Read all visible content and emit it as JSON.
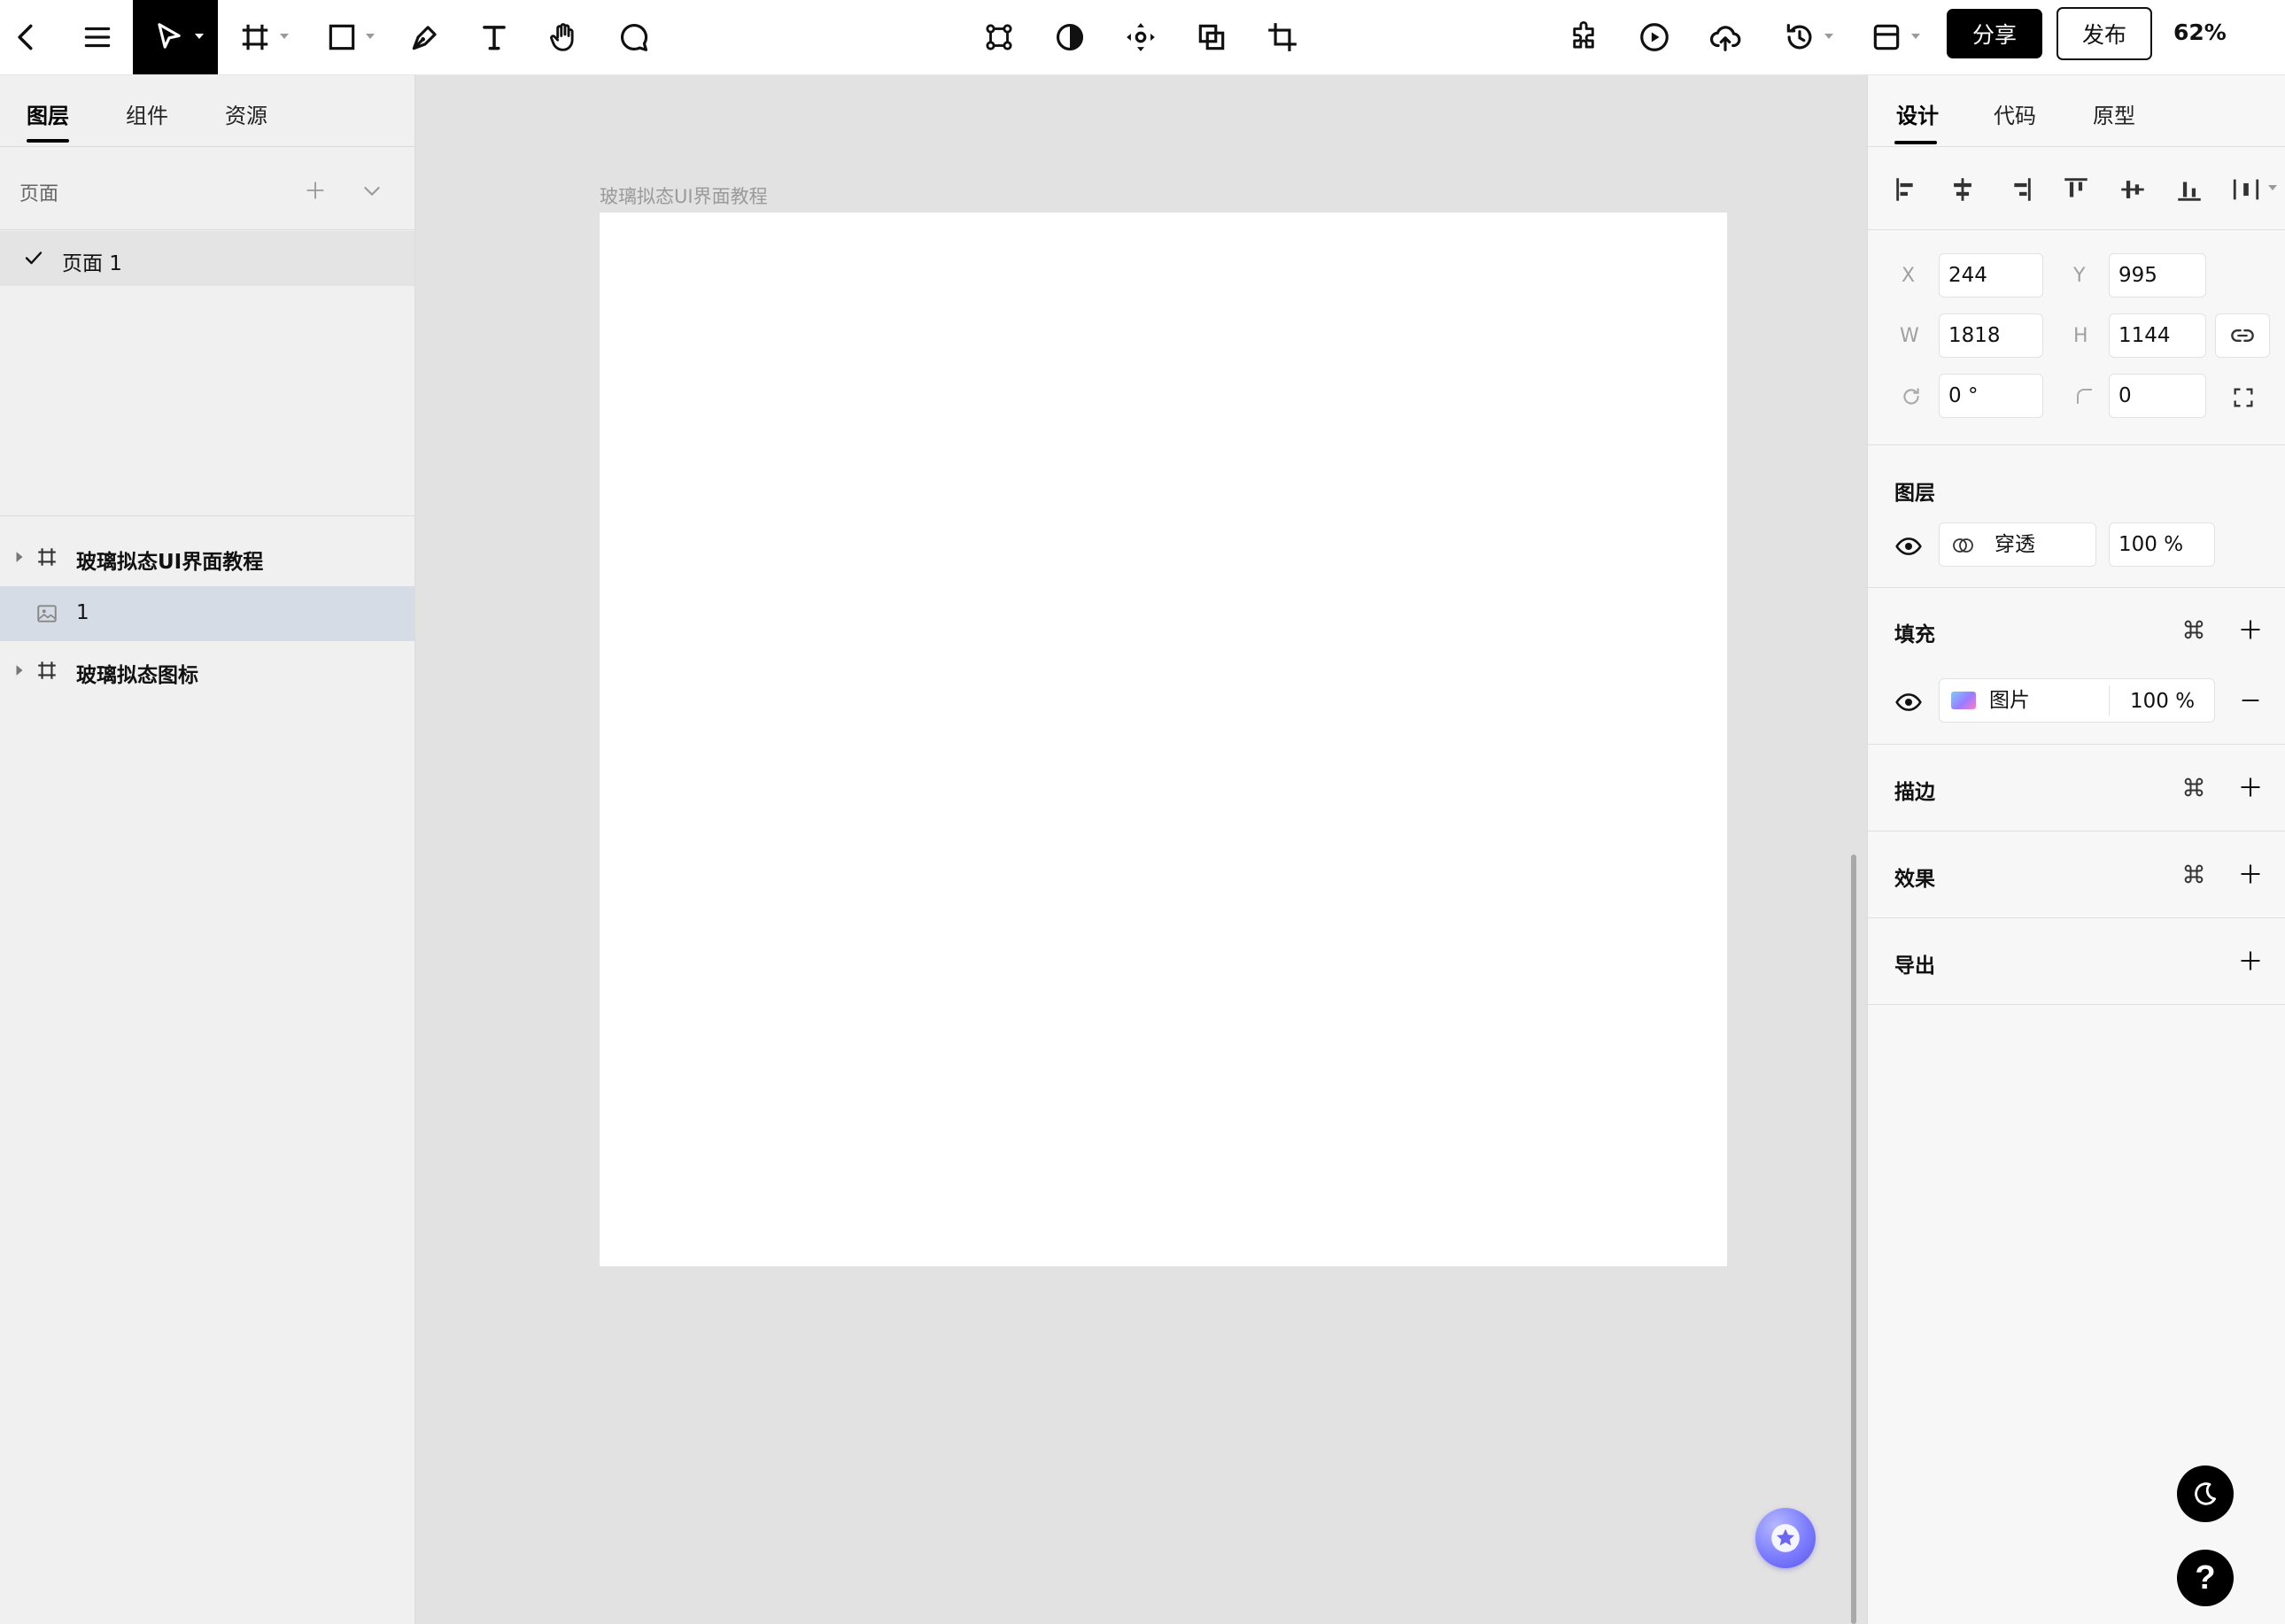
{
  "topbar": {
    "share_label": "分享",
    "publish_label": "发布",
    "zoom": "62%"
  },
  "left_panel": {
    "tabs": [
      {
        "label": "图层",
        "active": true
      },
      {
        "label": "组件",
        "active": false
      },
      {
        "label": "资源",
        "active": false
      }
    ],
    "pages_label": "页面",
    "pages": [
      {
        "label": "页面 1",
        "current": true
      }
    ],
    "layers": [
      {
        "label": "玻璃拟态UI界面教程",
        "type": "frame",
        "selected": false
      },
      {
        "label": "1",
        "type": "image",
        "selected": true
      },
      {
        "label": "玻璃拟态图标",
        "type": "frame",
        "selected": false
      }
    ]
  },
  "canvas": {
    "frame_title": "玻璃拟态UI界面教程"
  },
  "right_panel": {
    "tabs": [
      {
        "label": "设计",
        "active": true
      },
      {
        "label": "代码",
        "active": false
      },
      {
        "label": "原型",
        "active": false
      }
    ],
    "transform": {
      "x_label": "X",
      "x": "244",
      "y_label": "Y",
      "y": "995",
      "w_label": "W",
      "w": "1818",
      "h_label": "H",
      "h": "1144",
      "rotation": "0 °",
      "radius": "0"
    },
    "layer_section": {
      "title": "图层",
      "blend_mode": "穿透",
      "opacity": "100 %"
    },
    "fill_section": {
      "title": "填充",
      "fill_type": "图片",
      "opacity": "100 %"
    },
    "stroke_section": {
      "title": "描边"
    },
    "effect_section": {
      "title": "效果"
    },
    "export_section": {
      "title": "导出"
    }
  },
  "help_label": "?",
  "colors": {
    "accent": "#000000",
    "canvas_bg": "#e2e2e2",
    "selected_layer": "#d6dce6",
    "ai_bubble": "#7b7cff"
  }
}
